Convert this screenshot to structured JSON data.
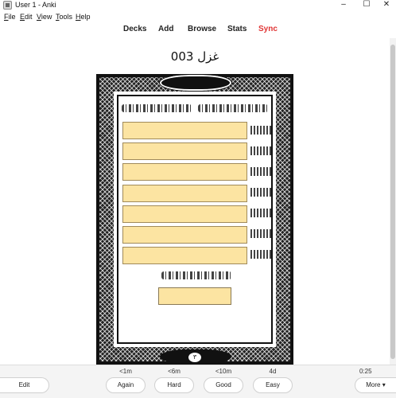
{
  "window": {
    "title": "User 1 - Anki",
    "minimize_glyph": "–",
    "maximize_glyph": "☐",
    "close_glyph": "✕"
  },
  "menu": {
    "items": [
      "File",
      "Edit",
      "View",
      "Tools",
      "Help"
    ]
  },
  "toolbar": {
    "decks": "Decks",
    "add": "Add",
    "browse": "Browse",
    "stats": "Stats",
    "sync": "Sync",
    "sync_color": "#e03434"
  },
  "card": {
    "title": "غزل 003",
    "page_number": "۳",
    "cloze_color": "#fce4a2"
  },
  "review": {
    "intervals": [
      "<1m",
      "<6m",
      "<10m",
      "4d"
    ],
    "timer": "0:25",
    "edit_label": "Edit",
    "again_label": "Again",
    "hard_label": "Hard",
    "good_label": "Good",
    "easy_label": "Easy",
    "more_label": "More ▾"
  }
}
